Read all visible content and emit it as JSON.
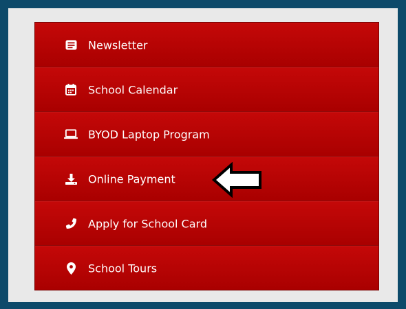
{
  "menu": {
    "items": [
      {
        "label": "Newsletter",
        "icon": "newspaper-icon"
      },
      {
        "label": "School Calendar",
        "icon": "calendar-icon"
      },
      {
        "label": "BYOD Laptop Program",
        "icon": "laptop-icon"
      },
      {
        "label": "Online Payment",
        "icon": "download-icon"
      },
      {
        "label": "Apply for School Card",
        "icon": "phone-icon"
      },
      {
        "label": "School Tours",
        "icon": "map-marker-icon"
      }
    ]
  },
  "colors": {
    "frame": "#0d4a6a",
    "panel": "#e9e9e9",
    "menu_red": "#b00000",
    "text": "#ffffff"
  },
  "annotation": {
    "icon": "left-arrow-pointer-icon"
  }
}
